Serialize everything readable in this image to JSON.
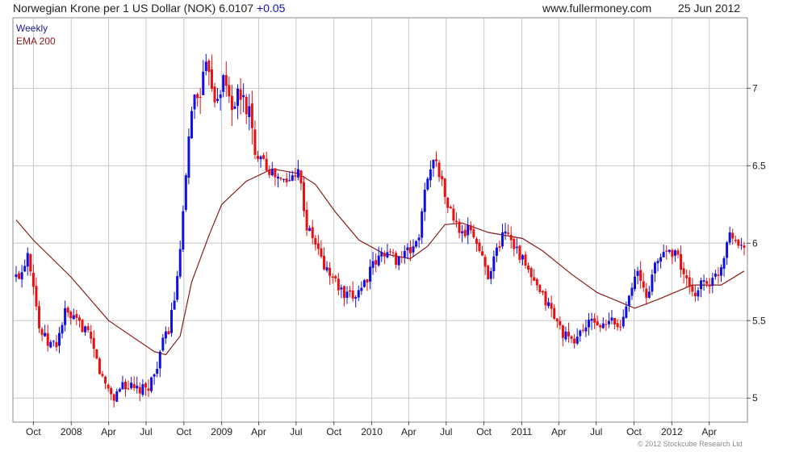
{
  "header": {
    "title": "Norwegian Krone per 1 US Dollar (NOK)",
    "last_value": "6.0107",
    "change": "+0.05",
    "site": "www.fullermoney.com",
    "date": "25 Jun 2012"
  },
  "legend": {
    "weekly": "Weekly",
    "ema": "EMA 200"
  },
  "footer": {
    "copyright": "© 2012 Stockcube Research Ltd"
  },
  "colors": {
    "up": "#1010e0",
    "down": "#e81010",
    "ema": "#8b1a1a",
    "grid": "#c8c8c8",
    "axis": "#555555",
    "legend_weekly": "#1a1a9a",
    "legend_ema": "#8b1a1a"
  },
  "chart_data": {
    "type": "candlestick",
    "title": "Norwegian Krone per 1 US Dollar (NOK)",
    "frequency": "Weekly",
    "x_range": [
      "2007-08-20",
      "2012-06-25"
    ],
    "ylim": [
      4.85,
      7.45
    ],
    "grid": true,
    "y_ticks": [
      {
        "label": "5",
        "value": 5
      },
      {
        "label": "5.5",
        "value": 5.5
      },
      {
        "label": "6",
        "value": 6
      },
      {
        "label": "6.5",
        "value": 6.5
      },
      {
        "label": "7",
        "value": 7
      }
    ],
    "x_ticks": [
      {
        "label": "Oct",
        "date": "2007-10-01"
      },
      {
        "label": "2008",
        "date": "2008-01-01"
      },
      {
        "label": "Apr",
        "date": "2008-04-01"
      },
      {
        "label": "Jul",
        "date": "2008-07-01"
      },
      {
        "label": "Oct",
        "date": "2008-10-01"
      },
      {
        "label": "2009",
        "date": "2009-01-01"
      },
      {
        "label": "Apr",
        "date": "2009-04-01"
      },
      {
        "label": "Jul",
        "date": "2009-07-01"
      },
      {
        "label": "Oct",
        "date": "2009-10-01"
      },
      {
        "label": "2010",
        "date": "2010-01-01"
      },
      {
        "label": "Apr",
        "date": "2010-04-01"
      },
      {
        "label": "Jul",
        "date": "2010-07-01"
      },
      {
        "label": "Oct",
        "date": "2010-10-01"
      },
      {
        "label": "2011",
        "date": "2011-01-01"
      },
      {
        "label": "Apr",
        "date": "2011-04-01"
      },
      {
        "label": "Jul",
        "date": "2011-07-01"
      },
      {
        "label": "Oct",
        "date": "2011-10-01"
      },
      {
        "label": "2012",
        "date": "2012-01-01"
      },
      {
        "label": "Apr",
        "date": "2012-04-01"
      }
    ],
    "price_series": {
      "name": "Weekly",
      "points": [
        [
          "2007-08-20",
          5.78
        ],
        [
          "2007-09-03",
          5.82
        ],
        [
          "2007-09-17",
          5.95
        ],
        [
          "2007-10-01",
          5.75
        ],
        [
          "2007-10-15",
          5.45
        ],
        [
          "2007-11-05",
          5.35
        ],
        [
          "2007-11-26",
          5.35
        ],
        [
          "2007-12-17",
          5.55
        ],
        [
          "2008-01-07",
          5.5
        ],
        [
          "2008-02-04",
          5.45
        ],
        [
          "2008-02-25",
          5.3
        ],
        [
          "2008-03-17",
          5.12
        ],
        [
          "2008-04-14",
          5.0
        ],
        [
          "2008-05-05",
          5.1
        ],
        [
          "2008-06-02",
          5.05
        ],
        [
          "2008-06-30",
          5.05
        ],
        [
          "2008-07-21",
          5.15
        ],
        [
          "2008-08-04",
          5.3
        ],
        [
          "2008-08-25",
          5.45
        ],
        [
          "2008-09-15",
          5.75
        ],
        [
          "2008-10-06",
          6.4
        ],
        [
          "2008-10-20",
          6.9
        ],
        [
          "2008-11-03",
          6.95
        ],
        [
          "2008-11-17",
          7.05
        ],
        [
          "2008-12-01",
          7.15
        ],
        [
          "2008-12-15",
          6.95
        ],
        [
          "2009-01-05",
          7.05
        ],
        [
          "2009-01-26",
          6.9
        ],
        [
          "2009-02-16",
          6.95
        ],
        [
          "2009-03-09",
          6.85
        ],
        [
          "2009-03-23",
          6.55
        ],
        [
          "2009-04-06",
          6.6
        ],
        [
          "2009-04-20",
          6.5
        ],
        [
          "2009-05-04",
          6.45
        ],
        [
          "2009-05-25",
          6.4
        ],
        [
          "2009-06-15",
          6.4
        ],
        [
          "2009-07-06",
          6.5
        ],
        [
          "2009-07-27",
          6.1
        ],
        [
          "2009-08-17",
          6.0
        ],
        [
          "2009-09-07",
          5.85
        ],
        [
          "2009-10-05",
          5.75
        ],
        [
          "2009-10-26",
          5.65
        ],
        [
          "2009-11-16",
          5.65
        ],
        [
          "2009-12-14",
          5.75
        ],
        [
          "2010-01-04",
          5.85
        ],
        [
          "2010-02-01",
          5.95
        ],
        [
          "2010-03-01",
          5.9
        ],
        [
          "2010-04-05",
          5.95
        ],
        [
          "2010-04-26",
          6.05
        ],
        [
          "2010-05-17",
          6.45
        ],
        [
          "2010-06-07",
          6.55
        ],
        [
          "2010-06-28",
          6.3
        ],
        [
          "2010-07-19",
          6.15
        ],
        [
          "2010-08-09",
          6.05
        ],
        [
          "2010-08-30",
          6.1
        ],
        [
          "2010-09-20",
          5.95
        ],
        [
          "2010-10-11",
          5.8
        ],
        [
          "2010-11-01",
          5.95
        ],
        [
          "2010-11-22",
          6.1
        ],
        [
          "2010-12-13",
          6.0
        ],
        [
          "2011-01-10",
          5.85
        ],
        [
          "2011-02-07",
          5.7
        ],
        [
          "2011-03-07",
          5.6
        ],
        [
          "2011-04-04",
          5.45
        ],
        [
          "2011-05-02",
          5.35
        ],
        [
          "2011-05-30",
          5.45
        ],
        [
          "2011-06-27",
          5.5
        ],
        [
          "2011-07-18",
          5.45
        ],
        [
          "2011-08-08",
          5.5
        ],
        [
          "2011-08-29",
          5.45
        ],
        [
          "2011-09-19",
          5.7
        ],
        [
          "2011-10-10",
          5.8
        ],
        [
          "2011-10-31",
          5.65
        ],
        [
          "2011-11-21",
          5.85
        ],
        [
          "2011-12-12",
          5.95
        ],
        [
          "2012-01-09",
          5.95
        ],
        [
          "2012-01-30",
          5.8
        ],
        [
          "2012-02-20",
          5.65
        ],
        [
          "2012-03-12",
          5.75
        ],
        [
          "2012-04-09",
          5.75
        ],
        [
          "2012-04-30",
          5.85
        ],
        [
          "2012-05-21",
          6.1
        ],
        [
          "2012-06-11",
          5.98
        ],
        [
          "2012-06-25",
          6.01
        ]
      ]
    },
    "ema_series": {
      "name": "EMA 200",
      "points": [
        [
          "2007-08-20",
          6.15
        ],
        [
          "2007-10-01",
          6.02
        ],
        [
          "2008-01-01",
          5.78
        ],
        [
          "2008-04-01",
          5.5
        ],
        [
          "2008-07-21",
          5.3
        ],
        [
          "2008-08-18",
          5.28
        ],
        [
          "2008-09-22",
          5.4
        ],
        [
          "2008-10-20",
          5.75
        ],
        [
          "2008-12-01",
          6.05
        ],
        [
          "2009-01-01",
          6.25
        ],
        [
          "2009-03-02",
          6.4
        ],
        [
          "2009-05-04",
          6.48
        ],
        [
          "2009-07-06",
          6.45
        ],
        [
          "2009-08-17",
          6.38
        ],
        [
          "2009-10-05",
          6.2
        ],
        [
          "2009-12-01",
          6.02
        ],
        [
          "2010-02-01",
          5.93
        ],
        [
          "2010-04-05",
          5.9
        ],
        [
          "2010-05-17",
          5.98
        ],
        [
          "2010-06-28",
          6.12
        ],
        [
          "2010-08-09",
          6.13
        ],
        [
          "2010-10-11",
          6.07
        ],
        [
          "2011-01-03",
          6.03
        ],
        [
          "2011-02-21",
          5.95
        ],
        [
          "2011-05-02",
          5.8
        ],
        [
          "2011-07-04",
          5.68
        ],
        [
          "2011-10-03",
          5.58
        ],
        [
          "2011-12-01",
          5.64
        ],
        [
          "2012-02-20",
          5.73
        ],
        [
          "2012-04-30",
          5.73
        ],
        [
          "2012-06-25",
          5.82
        ]
      ]
    }
  }
}
